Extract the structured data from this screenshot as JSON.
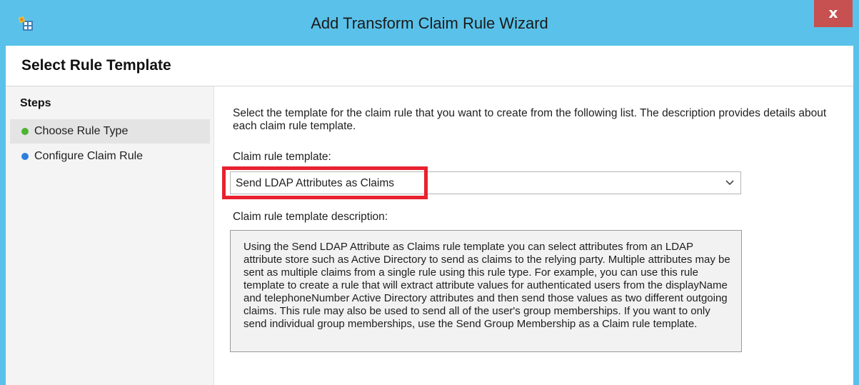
{
  "window": {
    "title": "Add Transform Claim Rule Wizard",
    "close_glyph": "x",
    "icon": "wizard-app-icon"
  },
  "header": {
    "title": "Select Rule Template"
  },
  "sidebar": {
    "heading": "Steps",
    "steps": [
      {
        "label": "Choose Rule Type",
        "status_color": "#4cb432",
        "current": true
      },
      {
        "label": "Configure Claim Rule",
        "status_color": "#2d7fde",
        "current": false
      }
    ]
  },
  "main": {
    "intro": "Select the template for the claim rule that you want to create from the following list. The description provides details about each claim rule template.",
    "template_label": "Claim rule template:",
    "template_value": "Send LDAP Attributes as Claims",
    "description_label": "Claim rule template description:",
    "description": "Using the Send LDAP Attribute as Claims rule template you can select attributes from an LDAP attribute store such as Active Directory to send as claims to the relying party. Multiple attributes may be sent as multiple claims from a single rule using this rule type. For example, you can use this rule template to create a rule that will extract attribute values for authenticated users from the displayName and telephoneNumber Active Directory attributes and then send those values as two different outgoing claims. This rule may also be used to send all of the user's group memberships. If you want to only send individual group memberships, use the Send Group Membership as a Claim rule template."
  },
  "colors": {
    "titlebar": "#5ac2ea",
    "close_button": "#c75050",
    "highlight": "#e8212f"
  }
}
